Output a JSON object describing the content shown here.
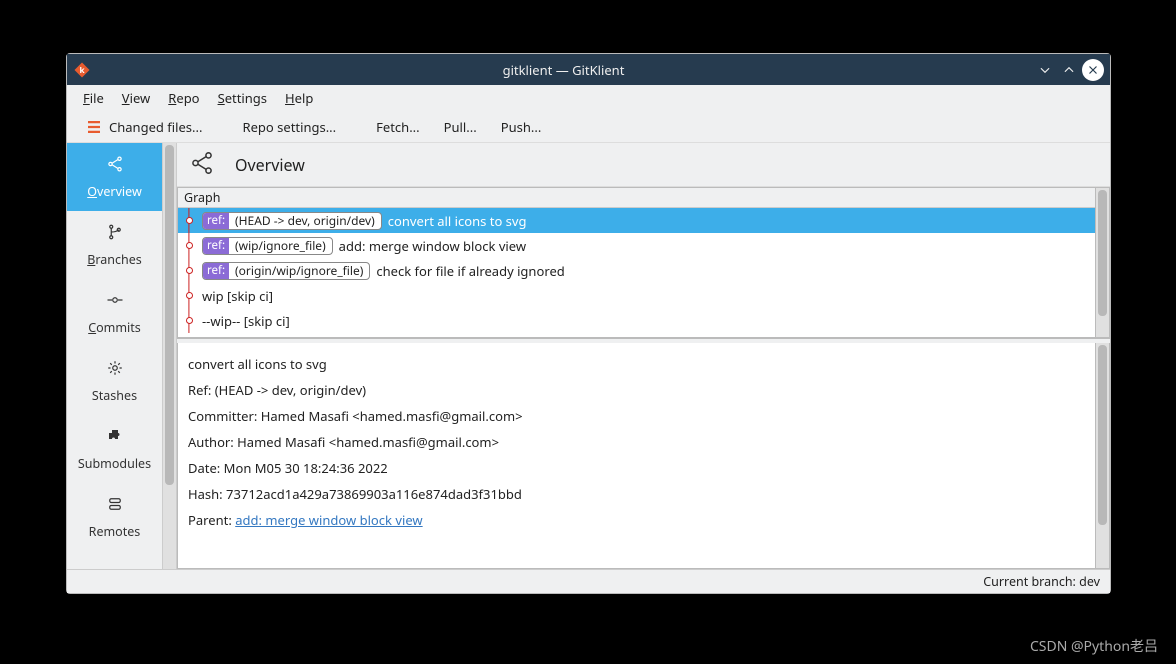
{
  "window": {
    "title": "gitklient — GitKlient",
    "icon": "app-k-icon"
  },
  "menubar": {
    "items": [
      "File",
      "View",
      "Repo",
      "Settings",
      "Help"
    ]
  },
  "toolbar": {
    "changed_files": "Changed files...",
    "repo_settings": "Repo settings...",
    "fetch": "Fetch...",
    "pull": "Pull...",
    "push": "Push..."
  },
  "sidebar": {
    "items": [
      {
        "label": "Overview",
        "icon": "share-icon",
        "active": true
      },
      {
        "label": "Branches",
        "icon": "branch-icon"
      },
      {
        "label": "Commits",
        "icon": "commit-icon"
      },
      {
        "label": "Stashes",
        "icon": "gear-icon"
      },
      {
        "label": "Submodules",
        "icon": "puzzle-icon"
      },
      {
        "label": "Remotes",
        "icon": "remote-icon"
      }
    ]
  },
  "main": {
    "title": "Overview",
    "graph_header": "Graph",
    "commits": [
      {
        "refLabel": "ref:",
        "refText": "(HEAD -> dev, origin/dev)",
        "msg": "convert all icons to svg",
        "selected": true
      },
      {
        "refLabel": "ref:",
        "refText": "(wip/ignore_file)",
        "msg": "add: merge window block view"
      },
      {
        "refLabel": "ref:",
        "refText": "(origin/wip/ignore_file)",
        "msg": "check for file if already ignored"
      },
      {
        "msg": "wip [skip ci]"
      },
      {
        "msg": "--wip-- [skip ci]"
      }
    ],
    "detail": {
      "subject": "convert all icons to svg",
      "ref_line": "Ref: (HEAD -> dev, origin/dev)",
      "committer_line": "Committer: Hamed Masafi <hamed.masfi@gmail.com>",
      "author_line": "Author: Hamed Masafi <hamed.masfi@gmail.com>",
      "date_line": "Date: Mon M05 30 18:24:36 2022",
      "hash_line": "Hash: 73712acd1a429a73869903a116e874dad3f31bbd",
      "parent_label": "Parent: ",
      "parent_link": "add: merge window block view"
    }
  },
  "statusbar": {
    "branch_text": "Current branch: dev"
  },
  "watermark": "CSDN @Python老吕"
}
